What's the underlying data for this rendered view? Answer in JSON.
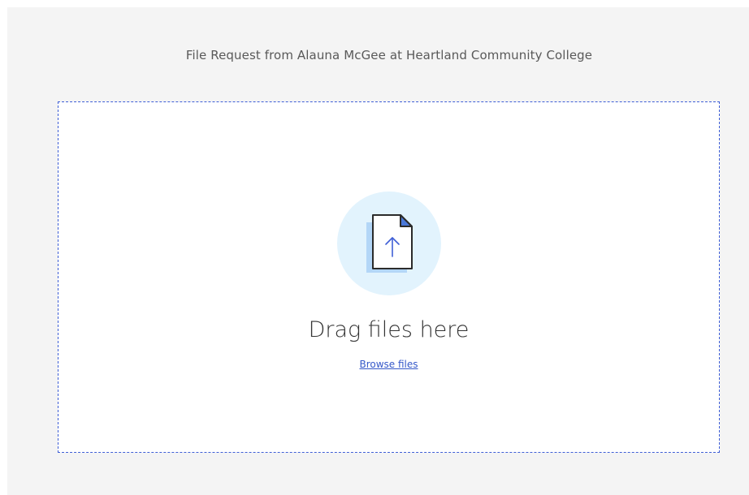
{
  "header": {
    "request_title": "File Request from Alauna McGee at Heartland Community College"
  },
  "dropzone": {
    "icon": "file-upload-icon",
    "prompt": "Drag files here",
    "browse_label": "Browse files"
  },
  "colors": {
    "page_background": "#f4f4f4",
    "dropzone_border": "#3f5fd6",
    "icon_circle": "#e2f3fd",
    "link": "#3558c9"
  }
}
